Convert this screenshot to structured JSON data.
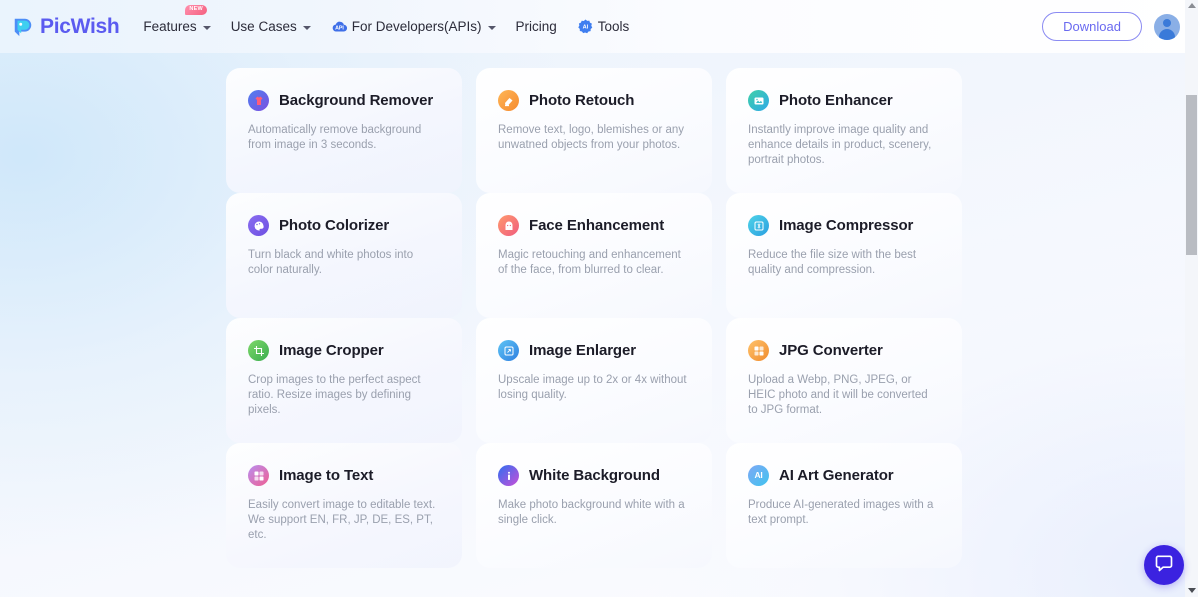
{
  "header": {
    "logo": {
      "text": "PicWish",
      "icon": "picwish-logo-icon",
      "color": "#5b5bf0"
    },
    "nav": [
      {
        "label": "Features",
        "icon": null,
        "caret": true,
        "badge": "NEW"
      },
      {
        "label": "Use Cases",
        "icon": null,
        "caret": true,
        "badge": null
      },
      {
        "label": "For Developers(APIs)",
        "icon": "api-cloud-icon",
        "caret": true,
        "badge": null
      },
      {
        "label": "Pricing",
        "icon": null,
        "caret": false,
        "badge": null
      },
      {
        "label": "Tools",
        "icon": "ai-gear-icon",
        "caret": false,
        "badge": null
      }
    ],
    "download_label": "Download",
    "avatar_icon": "user-avatar-icon"
  },
  "cards": [
    {
      "title": "Background Remover",
      "desc": "Automatically remove background from image in 3 seconds.",
      "icon": "tshirt-icon",
      "icon_bg_from": "#4f7ff0",
      "icon_bg_to": "#7b4fe0",
      "glyph": "shirt",
      "tint": "a"
    },
    {
      "title": "Photo Retouch",
      "desc": "Remove text, logo, blemishes or any unwatned objects from your photos.",
      "icon": "eraser-icon",
      "icon_bg_from": "#ffb657",
      "icon_bg_to": "#f58a2e",
      "glyph": "eraser",
      "tint": "b"
    },
    {
      "title": "Photo Enhancer",
      "desc": "Instantly improve image quality and enhance details in product, scenery, portrait photos.",
      "icon": "photo-frame-icon",
      "icon_bg_from": "#3fd0a8",
      "icon_bg_to": "#2fa9e8",
      "glyph": "photo",
      "tint": "b"
    },
    {
      "title": "Photo Colorizer",
      "desc": "Turn black and white photos into color naturally.",
      "icon": "palette-icon",
      "icon_bg_from": "#8a6ef0",
      "icon_bg_to": "#6d4fe2",
      "glyph": "palette",
      "tint": "a"
    },
    {
      "title": "Face Enhancement",
      "desc": "Magic retouching and enhancement of the face, from blurred to clear.",
      "icon": "face-icon",
      "icon_bg_from": "#ff9a6e",
      "icon_bg_to": "#f05c7e",
      "glyph": "face",
      "tint": "b"
    },
    {
      "title": "Image Compressor",
      "desc": "Reduce the file size with the best quality and compression.",
      "icon": "compress-icon",
      "icon_bg_from": "#4fd3e8",
      "icon_bg_to": "#2a9fe0",
      "glyph": "compress",
      "tint": "b"
    },
    {
      "title": "Image Cropper",
      "desc": "Crop images to the perfect aspect ratio. Resize images by defining pixels.",
      "icon": "crop-icon",
      "icon_bg_from": "#7fd96a",
      "icon_bg_to": "#3aac4f",
      "glyph": "crop",
      "tint": "a"
    },
    {
      "title": "Image Enlarger",
      "desc": "Upscale image up to 2x or 4x without losing quality.",
      "icon": "enlarge-icon",
      "icon_bg_from": "#5ec5f5",
      "icon_bg_to": "#2f7fe0",
      "glyph": "enlarge",
      "tint": "b"
    },
    {
      "title": "JPG Converter",
      "desc": "Upload a Webp, PNG, JPEG, or HEIC photo and it will be converted to JPG format.",
      "icon": "convert-icon",
      "icon_bg_from": "#ffc26b",
      "icon_bg_to": "#f08c2e",
      "glyph": "convert",
      "tint": "b"
    },
    {
      "title": "Image to Text",
      "desc": "Easily convert image to editable text. We support EN, FR, JP, DE, ES, PT, etc.",
      "icon": "image-to-text-icon",
      "icon_bg_from": "#b98ef0",
      "icon_bg_to": "#ef5f92",
      "glyph": "convert",
      "tint": "a"
    },
    {
      "title": "White Background",
      "desc": "Make photo background white with a single click.",
      "icon": "info-icon",
      "icon_bg_from": "#2f6ff0",
      "icon_bg_to": "#c94fd8",
      "glyph": "info",
      "tint": "b"
    },
    {
      "title": "AI Art Generator",
      "desc": "Produce AI-generated images with a text prompt.",
      "icon": "ai-art-icon",
      "icon_bg_from": "#7fa8f5",
      "icon_bg_to": "#3fc3ef",
      "glyph": "AI",
      "tint": "b"
    }
  ],
  "chat": {
    "icon": "chat-bubble-icon",
    "color": "#3b22e0"
  },
  "scrollbar": {
    "up_icon": "scroll-up-arrow-icon",
    "down_icon": "scroll-down-arrow-icon"
  }
}
